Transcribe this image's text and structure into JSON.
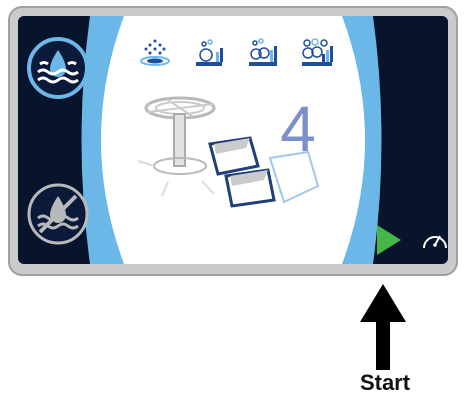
{
  "display": {
    "program_number": "4",
    "callout_label": "Start"
  },
  "icons": {
    "left_top": "water-waves-icon",
    "left_bottom": "no-water-waves-icon",
    "programs": [
      "shower-spray-icon",
      "bubbles-low-icon",
      "bubbles-medium-icon",
      "bubbles-high-icon"
    ],
    "start": "play-triangle-icon",
    "speed": "speedometer-icon"
  },
  "colors": {
    "screen_background": "#08132c",
    "accent_blue": "#6bb8e8",
    "number": "#7d8fc9",
    "start_green": "#45b649"
  }
}
